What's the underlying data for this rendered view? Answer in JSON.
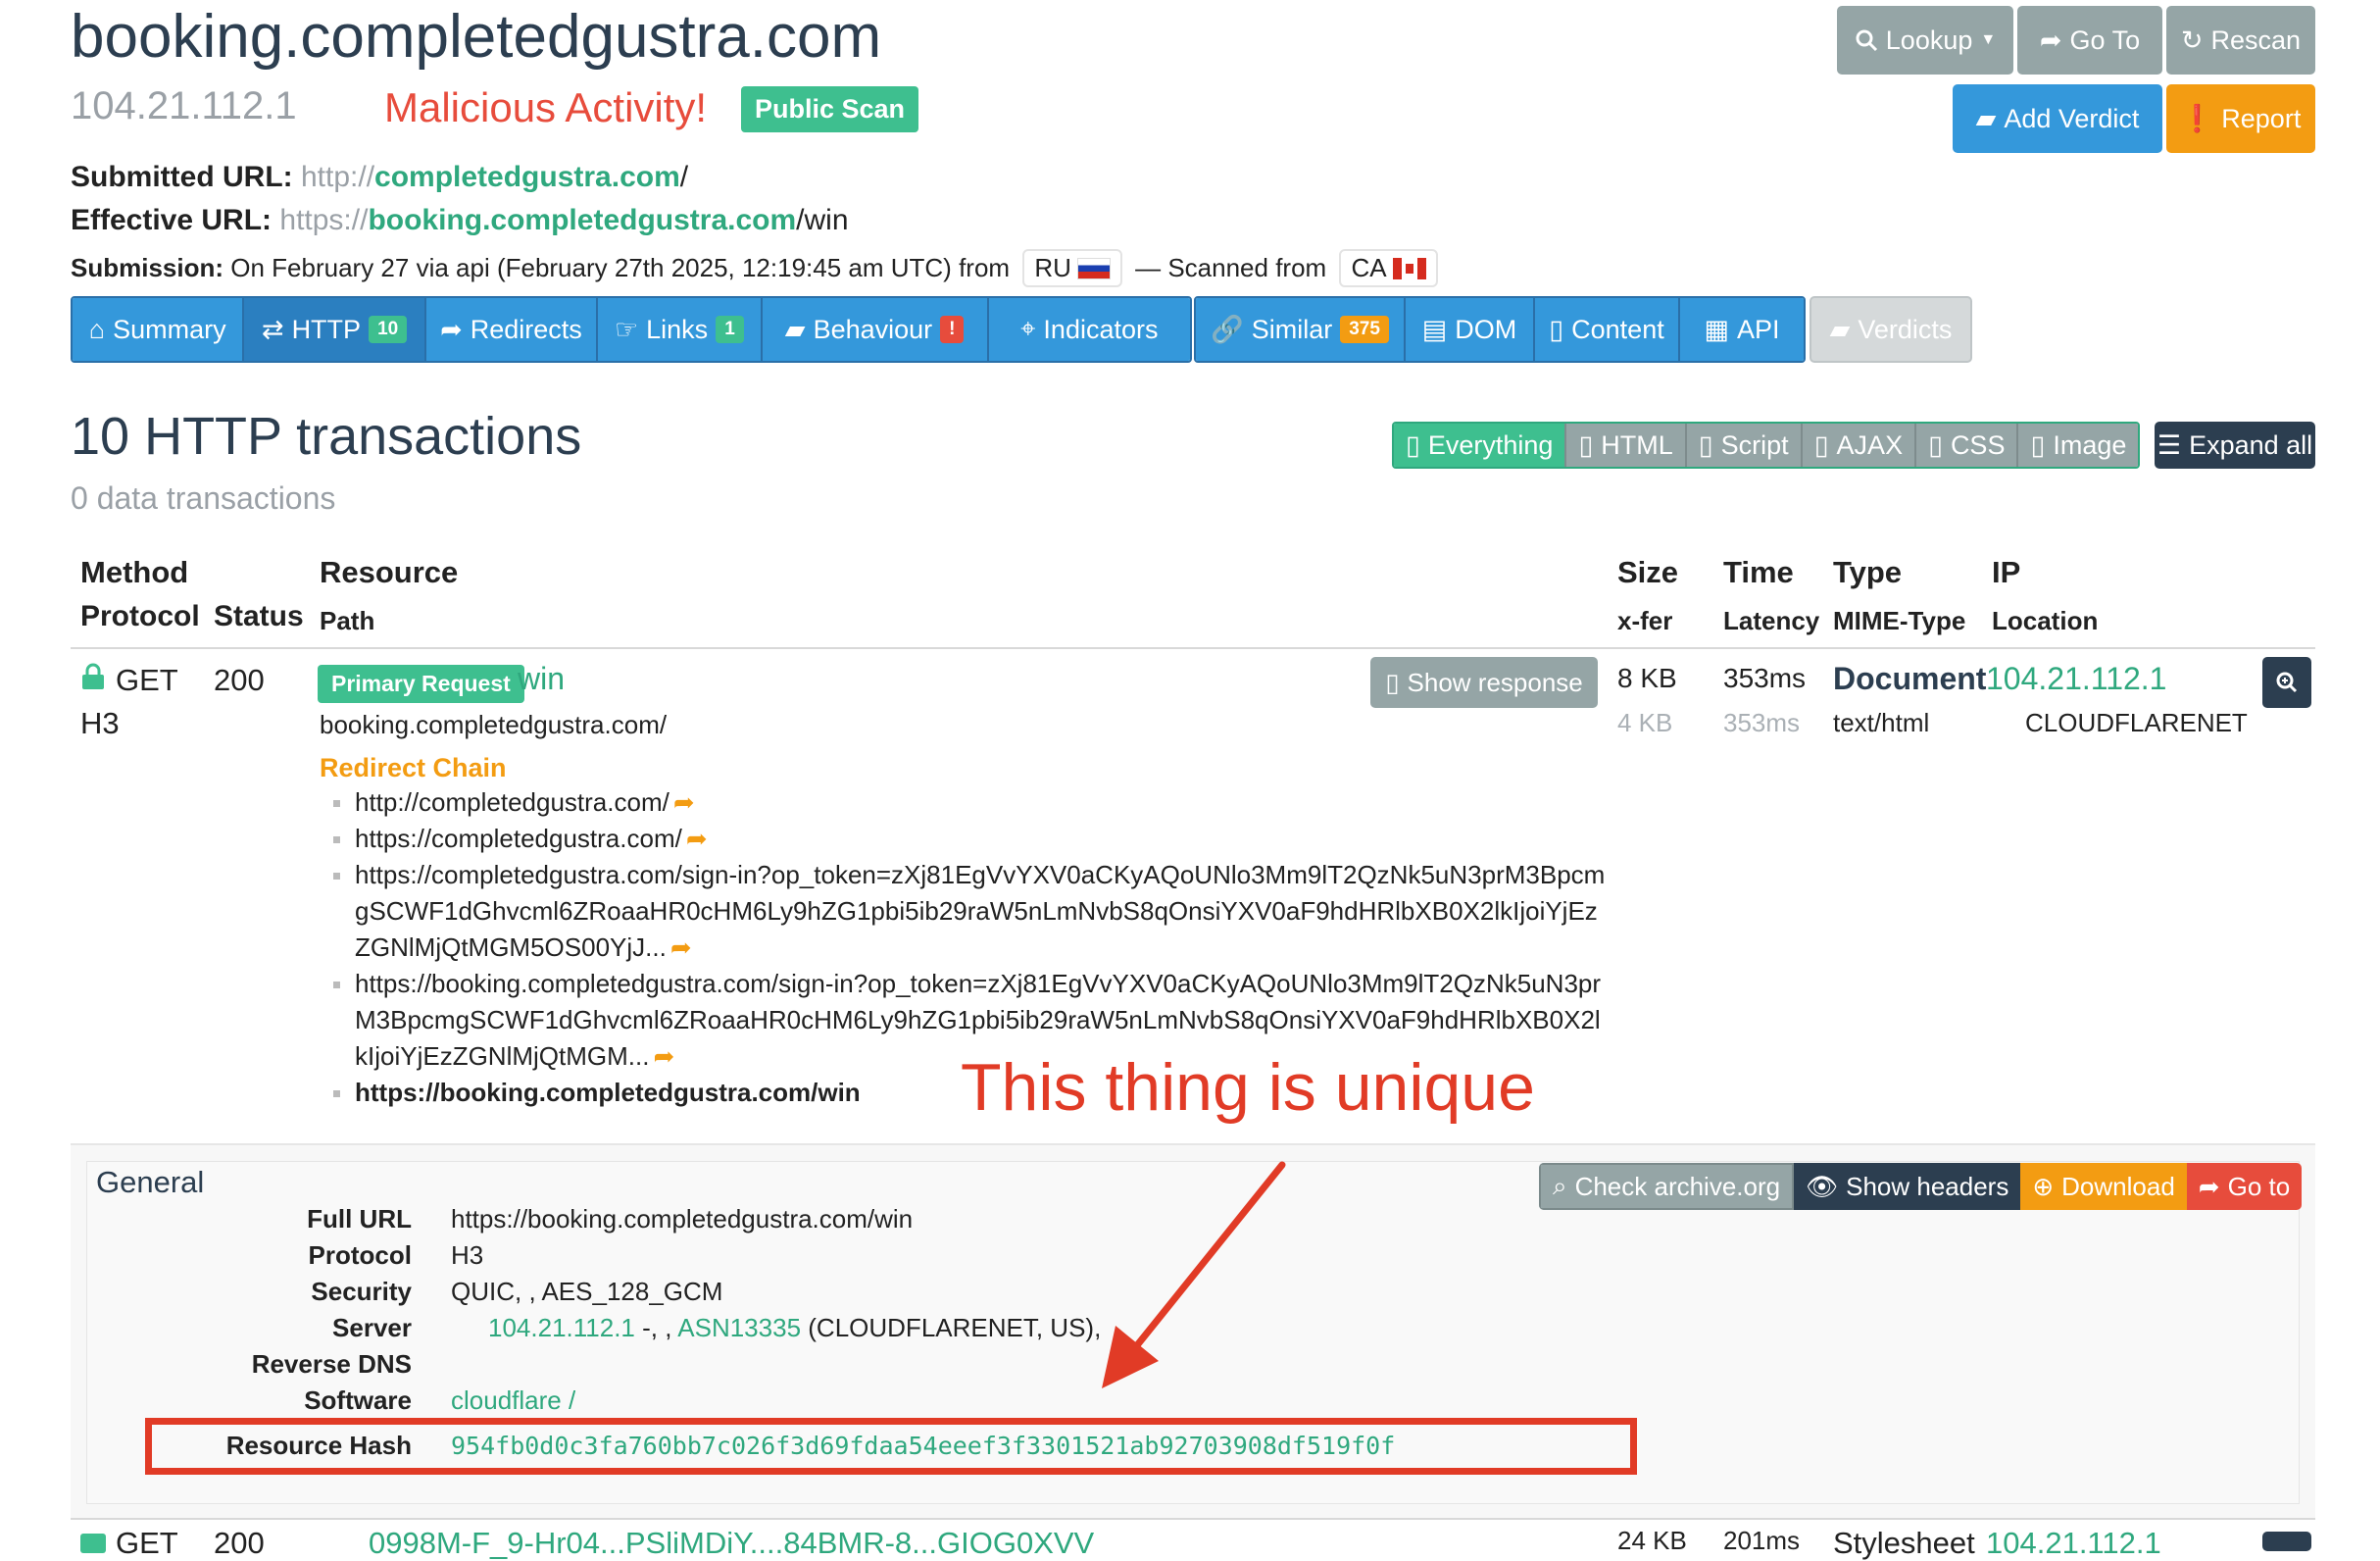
{
  "header": {
    "domain": "booking.completedgustra.com",
    "ip": "104.21.112.1",
    "verdict": "Malicious Activity!",
    "scan_visibility": "Public Scan"
  },
  "urls": {
    "submitted_label": "Submitted URL:",
    "submitted_scheme": "http://",
    "submitted_host": "completedgustra.com",
    "submitted_path": "/",
    "effective_label": "Effective URL:",
    "effective_scheme": "https://",
    "effective_host": "booking.completedgustra.com",
    "effective_path": "/win",
    "submission_label": "Submission:",
    "submission_text": "On February 27 via api (February 27th 2025, 12:19:45 am UTC) from",
    "from_country": "RU",
    "scanned_from_text": "— Scanned from",
    "scanned_country": "CA"
  },
  "actions": {
    "lookup": "Lookup",
    "goto": "Go To",
    "rescan": "Rescan",
    "add_verdict": "Add Verdict",
    "report": "Report"
  },
  "tabs": [
    {
      "label": "Summary"
    },
    {
      "label": "HTTP",
      "count": "10"
    },
    {
      "label": "Redirects"
    },
    {
      "label": "Links",
      "count": "1"
    },
    {
      "label": "Behaviour",
      "count": "!"
    },
    {
      "label": "Indicators"
    },
    {
      "label": "Similar",
      "count": "375"
    },
    {
      "label": "DOM"
    },
    {
      "label": "Content"
    },
    {
      "label": "API"
    },
    {
      "label": "Verdicts"
    }
  ],
  "section": {
    "title": "10 HTTP transactions",
    "subtitle": "0 data transactions",
    "filters": [
      "Everything",
      "HTML",
      "Script",
      "AJAX",
      "CSS",
      "Image"
    ],
    "expand_all": "Expand all"
  },
  "table_headers": {
    "method": "Method",
    "protocol": "Protocol",
    "status": "Status",
    "resource": "Resource",
    "path": "Path",
    "size": "Size",
    "xfer": "x-fer",
    "time": "Time",
    "latency": "Latency",
    "type": "Type",
    "mime": "MIME-Type",
    "ip": "IP",
    "location": "Location"
  },
  "row": {
    "method": "GET",
    "protocol": "H3",
    "status": "200",
    "badge": "Primary Request",
    "filename": "win",
    "path": "booking.completedgustra.com/",
    "redirect_chain_title": "Redirect Chain",
    "redirects": [
      "http://completedgustra.com/",
      "https://completedgustra.com/",
      "https://completedgustra.com/sign-in?op_token=zXj81EgVvYXV0aCKyAQoUNlo3Mm9lT2QzNk5uN3prM3BpcmgSCWF1dGhvcml6ZRoaaHR0cHM6Ly9hZG1pbi5ib29raW5nLmNvbS8qOnsiYXV0aF9hdHRlbXB0X2lkIjoiYjEzZGNlMjQtMGM5OS00YjJ...",
      "https://booking.completedgustra.com/sign-in?op_token=zXj81EgVvYXV0aCKyAQoUNlo3Mm9lT2QzNk5uN3prM3BpcmgSCWF1dGhvcml6ZRoaaHR0cHM6Ly9hZG1pbi5ib29raW5nLmNvbS8qOnsiYXV0aF9hdHRlbXB0X2lkIjoiYjEzZGNlMjQtMGM...",
      "https://booking.completedgustra.com/win"
    ],
    "show_response": "Show response",
    "size": "8 KB",
    "xfer": "4 KB",
    "time": "353ms",
    "latency": "353ms",
    "type": "Document",
    "mime": "text/html",
    "ip": "104.21.112.1",
    "location": "CLOUDFLARENET"
  },
  "general": {
    "title": "General",
    "buttons": [
      "Check archive.org",
      "Show headers",
      "Download",
      "Go to"
    ],
    "full_url_label": "Full URL",
    "full_url": "https://booking.completedgustra.com/win",
    "protocol_label": "Protocol",
    "protocol": "H3",
    "security_label": "Security",
    "security": "QUIC, , AES_128_GCM",
    "server_label": "Server",
    "server_ip": "104.21.112.1",
    "server_sep": "-, ,",
    "server_asn": "ASN13335",
    "server_org": "(CLOUDFLARENET, US),",
    "reverse_dns_label": "Reverse DNS",
    "software_label": "Software",
    "software": "cloudflare /",
    "resource_hash_label": "Resource Hash",
    "resource_hash": "954fb0d0c3fa760bb7c026f3d69fdaa54eeef3f3301521ab92703908df519f0f"
  },
  "annotation": {
    "text": "This thing is unique",
    "color": "#e13b26"
  },
  "next_row": {
    "method": "GET",
    "status": "200",
    "resource": "0998M-F_9-Hr04...PSliMDiY....84BMR-8...GIOG0XVV",
    "size": "24 KB",
    "time": "201ms",
    "type": "Stylesheet",
    "ip": "104.21.112.1"
  },
  "colors": {
    "accent_green": "#2fa87e",
    "badge_green": "#3ebf8f",
    "tab_blue": "#3498db",
    "malicious_red": "#e74c3c",
    "warn_orange": "#f39c12",
    "dark": "#2c3e50",
    "grey_button": "#95a5a6"
  }
}
